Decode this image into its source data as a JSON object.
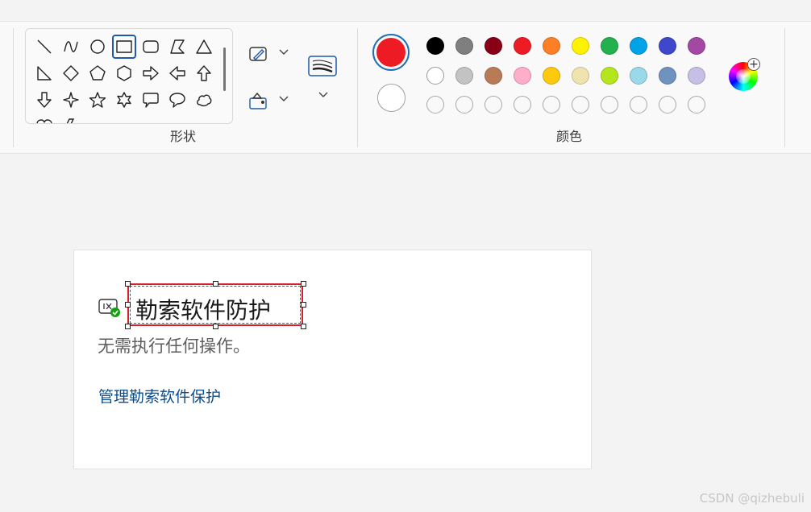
{
  "ribbon": {
    "shapes_label": "形状",
    "colors_label": "颜色"
  },
  "shapes": [
    "line",
    "curve",
    "oval",
    "rectangle",
    "rounded-rectangle",
    "polygon",
    "triangle",
    "right-triangle",
    "diamond",
    "pentagon",
    "hexagon",
    "right-arrow",
    "left-arrow",
    "up-arrow",
    "down-arrow",
    "four-point-star",
    "five-point-star",
    "six-point-star",
    "rect-callout",
    "oval-callout",
    "cloud-callout"
  ],
  "selected_shape": "rectangle",
  "colors": {
    "color1": "#ed1c24",
    "color2": "#ffffff",
    "palette_row1": [
      "#000000",
      "#7f7f7f",
      "#880015",
      "#ed1c24",
      "#ff7f27",
      "#fff200",
      "#22b14c",
      "#00a2e8",
      "#3f48cc",
      "#a349a4"
    ],
    "palette_row2": [
      "#ffffff",
      "#c3c3c3",
      "#b97a57",
      "#ffaec9",
      "#ffc90e",
      "#efe4b0",
      "#b5e61d",
      "#99d9ea",
      "#7092be",
      "#c8bfe7"
    ],
    "palette_row3_empty": 10
  },
  "canvas": {
    "title": "勒索软件防护",
    "subtitle": "无需执行任何操作。",
    "link": "管理勒索软件保护"
  },
  "watermark": "CSDN @qizhebuli"
}
